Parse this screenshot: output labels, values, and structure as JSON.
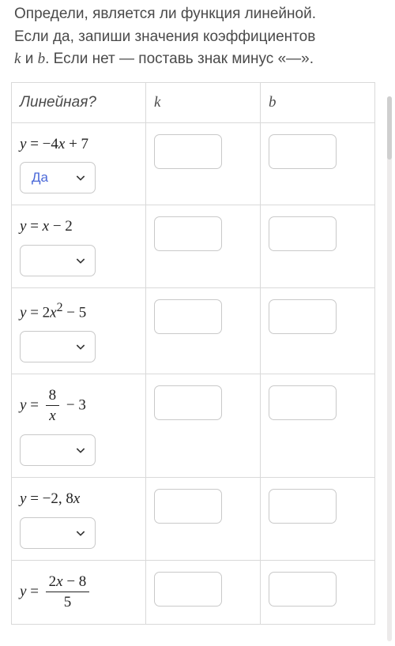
{
  "instructions": {
    "line1": "Определи, является ли функция линейной.",
    "line2_a": "Если да, запиши значения коэффициентов",
    "line3_a": "k",
    "line3_b": " и ",
    "line3_c": "b",
    "line3_d": ". Если нет — поставь знак минус «—»."
  },
  "headers": {
    "linear": "Линейная?",
    "k": "k",
    "b": "b"
  },
  "rows": [
    {
      "formula_html": "<span class='ital'>y</span> <span class='num'>=</span> <span class='num'>−4</span><span class='ital'>x</span> <span class='num'>+</span> <span class='num'>7</span>",
      "select_value": "Да",
      "k": "",
      "b": ""
    },
    {
      "formula_html": "<span class='ital'>y</span> <span class='num'>=</span> <span class='ital'>x</span> <span class='num'>− 2</span>",
      "select_value": "",
      "k": "",
      "b": ""
    },
    {
      "formula_html": "<span class='ital'>y</span> <span class='num'>=</span> <span class='num'>2</span><span class='ital'>x</span><sup class='num'>2</sup> <span class='num'>− 5</span>",
      "select_value": "",
      "k": "",
      "b": ""
    },
    {
      "formula_html": "<span class='ital'>y</span> <span class='num'>=</span> <span class='frac'><span class='fn'>8</span><span class='fd'><span class='ital-x'>x</span></span></span> <span class='num'>− 3</span>",
      "select_value": "",
      "k": "",
      "b": ""
    },
    {
      "formula_html": "<span class='ital'>y</span> <span class='num'>=</span> <span class='num'>−2, 8</span><span class='ital'>x</span>",
      "select_value": "",
      "k": "",
      "b": ""
    },
    {
      "formula_html": "<span class='ital'>y</span> <span class='num'>=</span> <span class='frac'><span class='fn'>2<span class='ital-x'>x</span> − 8</span><span class='fd'>5</span></span>",
      "select_value": "",
      "k": "",
      "b": ""
    }
  ]
}
